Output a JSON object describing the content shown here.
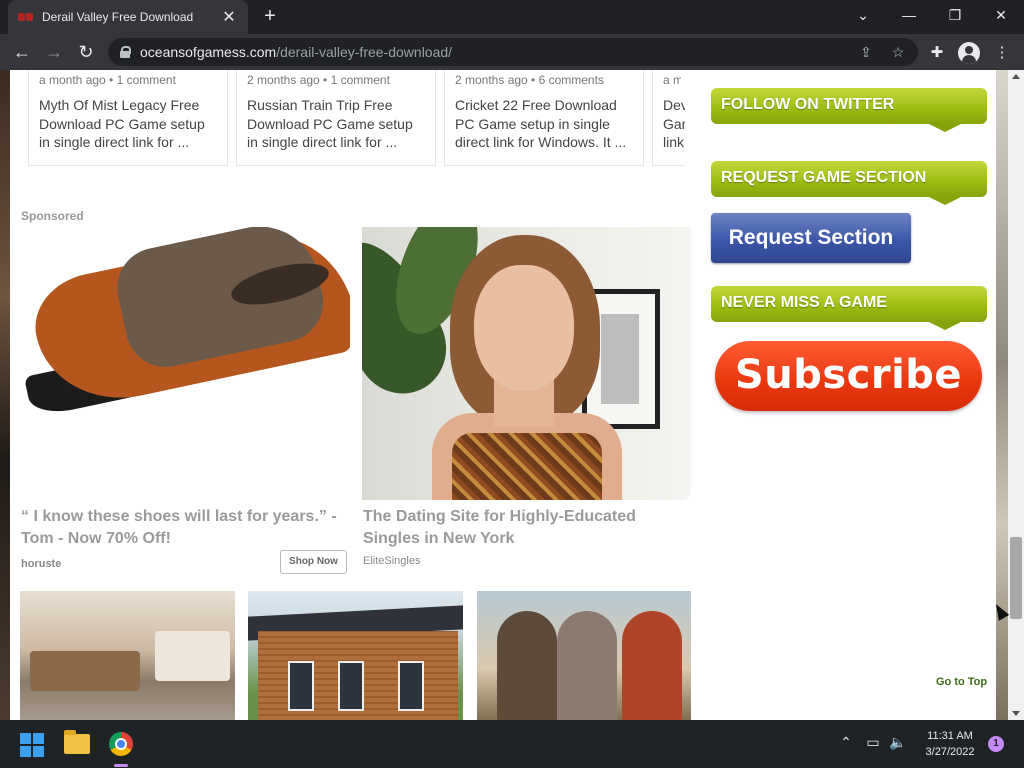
{
  "browser": {
    "tab_title": "Derail Valley Free Download",
    "url_host": "oceansofgamess.com",
    "url_path": "/derail-valley-free-download/"
  },
  "related_posts": [
    {
      "meta": "a month ago • 1 comment",
      "text": "Myth Of Mist Legacy Free Download PC Game setup in single direct link for ..."
    },
    {
      "meta": "2 months ago • 1 comment",
      "text": "Russian Train Trip Free Download PC Game setup in single direct link for ..."
    },
    {
      "meta": "2 months ago • 6 comments",
      "text": "Cricket 22 Free Download PC Game setup in single direct link for Windows. It ..."
    },
    {
      "meta": "a m",
      "text": "Dev Gar link"
    }
  ],
  "sponsored_label": "Sponsored",
  "ads": {
    "ad1": {
      "title": "“ I know these shoes will last for years.” - Tom - Now 70% Off!",
      "source": "horuste",
      "button": "Shop Now"
    },
    "ad2": {
      "title": "The Dating Site for Highly-Educated Singles in New York",
      "source": "EliteSingles"
    }
  },
  "sidebar": {
    "follow_twitter": "FOLLOW ON TWITTER",
    "request_game_section": "REQUEST GAME SECTION",
    "request_button": "Request Section",
    "never_miss": "NEVER MISS A GAME",
    "subscribe_button": "Subscribe",
    "go_to_top": "Go to Top"
  },
  "taskbar": {
    "time": "11:31 AM",
    "date": "3/27/2022",
    "notification_count": "1"
  },
  "colors": {
    "banner_green": "#9bbb12",
    "request_blue": "#3c57a8",
    "subscribe_red": "#e8370f",
    "go_top_green": "#3f6e1c"
  }
}
